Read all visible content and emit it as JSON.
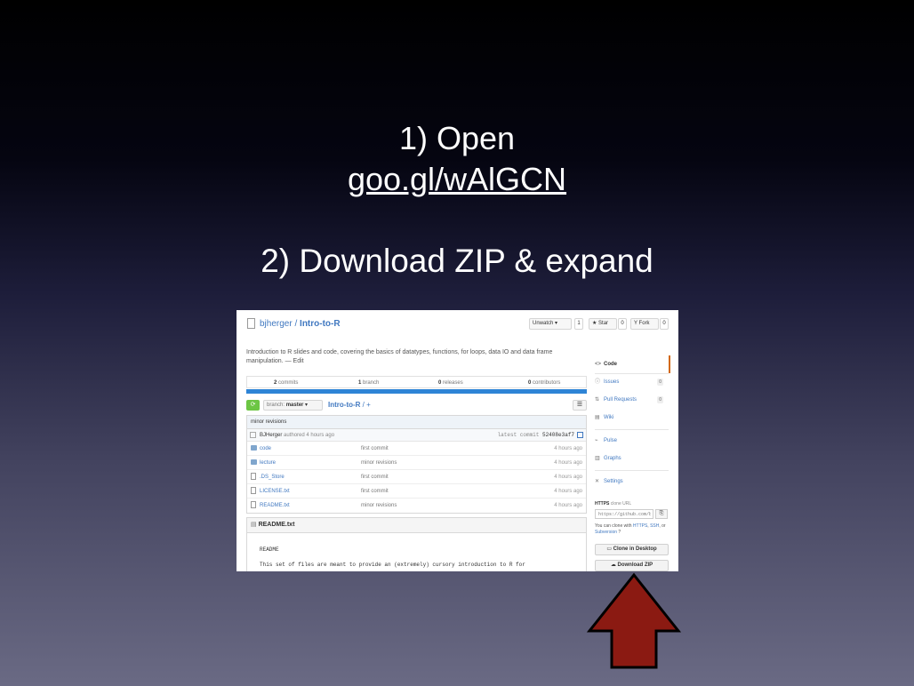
{
  "slide": {
    "line1": "1) Open",
    "line2": "goo.gl/wAlGCN",
    "line3": "2) Download ZIP & expand"
  },
  "repo": {
    "owner": "bjherger",
    "separator": " / ",
    "name": "Intro-to-R",
    "description": "Introduction to R slides and code, covering the basics of datatypes, functions, for loops, data IO and data frame manipulation. — Edit",
    "unwatch_label": "Unwatch ▾",
    "unwatch_count": "1",
    "star_label": "★ Star",
    "star_count": "0",
    "fork_label": "Y Fork",
    "fork_count": "0"
  },
  "stats": {
    "commits_count": "2",
    "commits_label": " commits",
    "branch_count": "1",
    "branch_label": " branch",
    "releases_count": "0",
    "releases_label": " releases",
    "contributors_count": "0",
    "contributors_label": " contributors"
  },
  "toolbar": {
    "sync_icon": "⟳",
    "branch_prefix": "branch: ",
    "branch_name": "master",
    "branch_caret": "▾",
    "breadcrumb_repo": "Intro-to-R",
    "breadcrumb_suffix": " / +",
    "list_icon": "☰"
  },
  "commit": {
    "message": "minor revisions",
    "author": "BJHerger",
    "authored": "authored 4 hours ago",
    "latest_label": "latest commit",
    "sha": "52408e3af7"
  },
  "files": [
    {
      "name": "code",
      "type": "dir",
      "message": "first commit",
      "age": "4 hours ago"
    },
    {
      "name": "lecture",
      "type": "dir",
      "message": "minor revisions",
      "age": "4 hours ago"
    },
    {
      "name": ".DS_Store",
      "type": "file",
      "message": "first commit",
      "age": "4 hours ago"
    },
    {
      "name": "LICENSE.txt",
      "type": "file",
      "message": "first commit",
      "age": "4 hours ago"
    },
    {
      "name": "README.txt",
      "type": "file",
      "message": "minor revisions",
      "age": "4 hours ago"
    }
  ],
  "readme": {
    "header": "README.txt",
    "title": "README",
    "body": "This set of files are meant to provide an (extremely) cursory introduction to R for"
  },
  "sidebar": {
    "code": "Code",
    "issues": "Issues",
    "issues_count": "0",
    "pulls": "Pull Requests",
    "pulls_count": "0",
    "wiki": "Wiki",
    "pulse": "Pulse",
    "graphs": "Graphs",
    "settings": "Settings"
  },
  "clone": {
    "label_strong": "HTTPS",
    "label_rest": " clone URL",
    "url_value": "https://github.com/b",
    "help_prefix": "You can clone with ",
    "help_https": "HTTPS",
    "help_ssh": "SSH",
    "help_or": ", or ",
    "help_svn": "Subversion",
    "help_sep": ", ",
    "clone_desktop": "Clone in Desktop",
    "download_zip": "Download ZIP"
  },
  "colors": {
    "accent": "#4078c0",
    "sync_green": "#6cc644",
    "language_bar": "#2e84d6",
    "arrow_fill": "#8b1a12"
  }
}
